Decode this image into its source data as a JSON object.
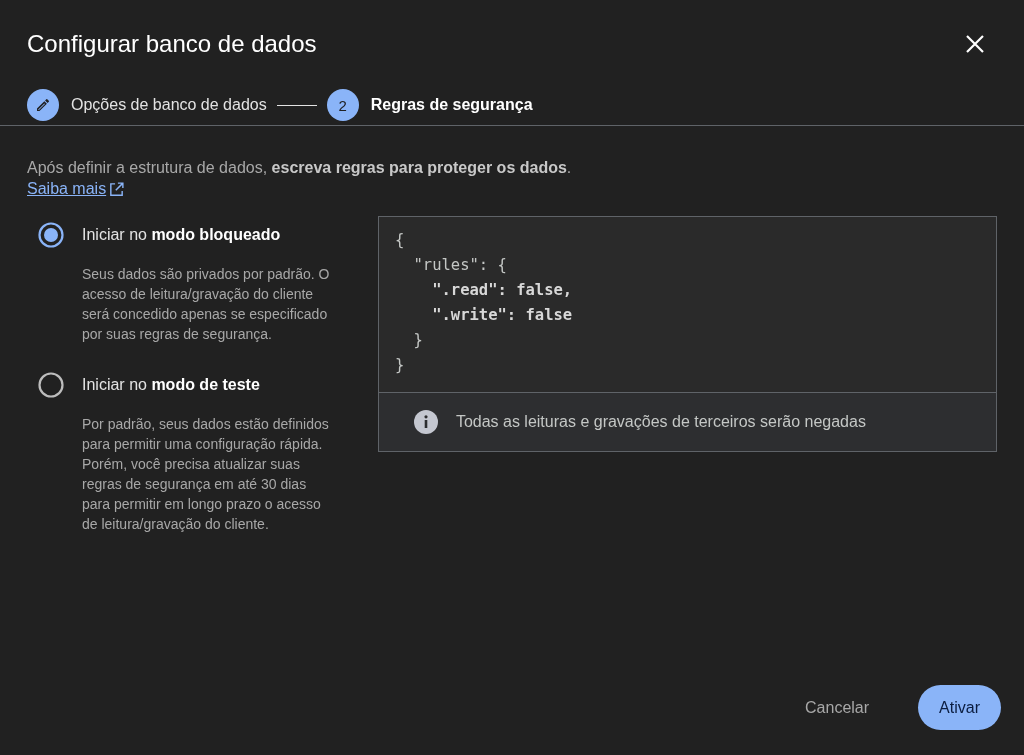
{
  "dialog": {
    "title": "Configurar banco de dados"
  },
  "steps": [
    {
      "kind": "edit",
      "label": "Opções de banco de dados",
      "selected": false
    },
    {
      "kind": "number",
      "number": "2",
      "label": "Regras de segurança",
      "selected": true
    }
  ],
  "intro": "Após definir a estrutura de dados, **escreva regras para proteger os dados**.",
  "learn_more": "Saiba mais",
  "modes": [
    {
      "label": "Iniciar no **modo bloqueado**",
      "description": "Seus dados são privados por padrão. O acesso de leitura/gravação do cliente será concedido apenas se especificado por suas regras de segurança.",
      "selected": true
    },
    {
      "label": "Iniciar no **modo de teste**",
      "description": "Por padrão, seus dados estão definidos para permitir uma configuração rápida. Porém, você precisa atualizar suas regras de segurança em até 30 dias para permitir em longo prazo o acesso de leitura/gravação do cliente.",
      "selected": false
    }
  ],
  "code_lines": [
    {
      "text": "{",
      "emphasized": false
    },
    {
      "text": "  \"rules\": {",
      "emphasized": false
    },
    {
      "text": "    \".read\": false,",
      "emphasized": true
    },
    {
      "text": "    \".write\": false",
      "emphasized": true
    },
    {
      "text": "  }",
      "emphasized": false
    },
    {
      "text": "}",
      "emphasized": false
    }
  ],
  "notice": "Todas as leituras e gravações de terceiros serão negadas",
  "buttons": [
    {
      "kind": "text",
      "label": "Cancelar"
    },
    {
      "kind": "filled",
      "label": "Ativar"
    }
  ]
}
